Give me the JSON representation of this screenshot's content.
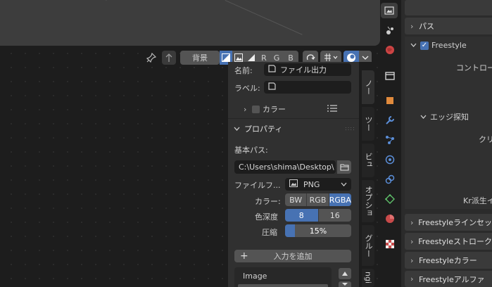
{
  "header": {
    "background_label": "背景",
    "channel_r": "R",
    "channel_g": "G",
    "channel_b": "B"
  },
  "node_panel": {
    "name_label": "名前:",
    "name_value": "ファイル出力",
    "label_label": "ラベル:",
    "color_section": "カラー",
    "properties_section": "プロパティ",
    "base_path_label": "基本パス:",
    "base_path_value": "C:\\Users\\shima\\Desktop\\",
    "file_format_label": "ファイルフ...",
    "file_format_value": "PNG",
    "color_label": "カラー:",
    "color_options": [
      "BW",
      "RGB",
      "RGBA"
    ],
    "color_selected": "RGBA",
    "depth_label": "色深度",
    "depth_options": [
      "8",
      "16"
    ],
    "depth_selected": "8",
    "compression_label": "圧縮",
    "compression_value": "15%",
    "compression_fraction": 0.15,
    "add_input_label": "入力を追加",
    "input_item": "Image"
  },
  "side_tabs": [
    "ノー",
    "ツー",
    "ビュ",
    "オプショ",
    "グルー",
    "ngi"
  ],
  "properties": {
    "pass_label": "パス",
    "freestyle_label": "Freestyle",
    "control_label": "コントロー",
    "edge_detect_label": "エッジ探知",
    "crease_label": "クリ",
    "kr_label": "Kr派生イ",
    "panels": [
      "Freestyleラインセッ",
      "Freestyleストローク",
      "Freestyleカラー",
      "Freestyleアルファ"
    ]
  },
  "colors": {
    "accent": "#4772b3",
    "panel": "#303030",
    "background": "#1d1d1d"
  }
}
